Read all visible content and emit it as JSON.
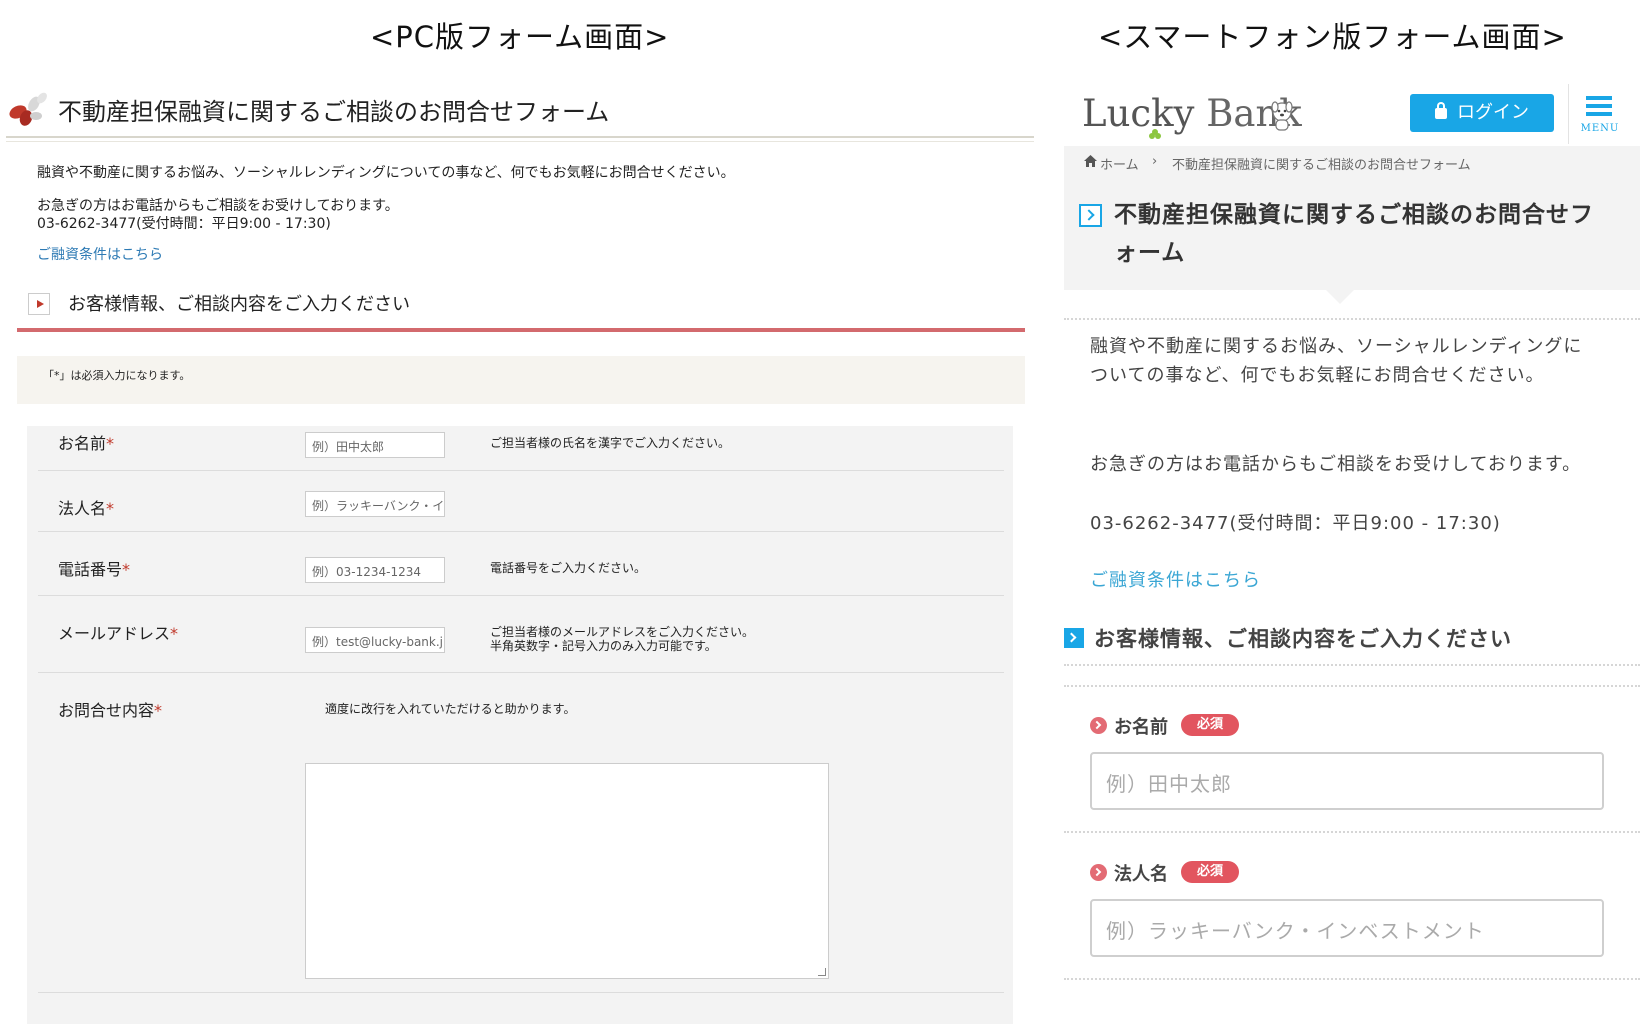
{
  "captions": {
    "pc": "<PC版フォーム画面>",
    "sp": "<スマートフォン版フォーム画面>"
  },
  "pc": {
    "title": "不動産担保融資に関するご相談のお問合せフォーム",
    "intro1": "融資や不動産に関するお悩み、ソーシャルレンディングについての事など、何でもお気軽にお問合せください。",
    "intro2": "お急ぎの方はお電話からもご相談をお受けしております。",
    "intro3": "03-6262-3477(受付時間：平日9:00 - 17:30)",
    "link": "ご融資条件はこちら",
    "section_title": "お客様情報、ご相談内容をご入力ください",
    "note": "「*」は必須入力になります。",
    "required_mark": "*",
    "fields": [
      {
        "label": "お名前",
        "placeholder": "例）田中太郎",
        "help": "ご担当者様の氏名を漢字でご入力ください。",
        "help2": ""
      },
      {
        "label": "法人名",
        "placeholder": "例）ラッキーバンク・インベストメント",
        "help": "",
        "help2": ""
      },
      {
        "label": "電話番号",
        "placeholder": "例）03-1234-1234",
        "help": "電話番号をご入力ください。",
        "help2": ""
      },
      {
        "label": "メールアドレス",
        "placeholder": "例）test@lucky-bank.jp",
        "help": "ご担当者様のメールアドレスをご入力ください。",
        "help2": "半角英数字・記号入力のみ入力可能です。"
      },
      {
        "label": "お問合せ内容",
        "placeholder": "",
        "help": "適度に改行を入れていただけると助かります。",
        "help2": ""
      }
    ]
  },
  "sp": {
    "logo_lucky": "Lucky",
    "logo_bank": "Bank",
    "login_label": "ログイン",
    "menu_label": "MENU",
    "breadcrumb_home": "ホーム",
    "breadcrumb_sep": "›",
    "breadcrumb_current": "不動産担保融資に関するご相談のお問合せフォーム",
    "title": "不動産担保融資に関するご相談のお問合せフォーム",
    "intro1": "融資や不動産に関するお悩み、ソーシャルレンディングについての事など、何でもお気軽にお問合せください。",
    "intro2": "お急ぎの方はお電話からもご相談をお受けしております。",
    "intro3": "03-6262-3477(受付時間：平日9:00 - 17:30)",
    "link": "ご融資条件はこちら",
    "section_title": "お客様情報、ご相談内容をご入力ください",
    "required_badge": "必須",
    "fields": [
      {
        "label": "お名前",
        "placeholder": "例）田中太郎"
      },
      {
        "label": "法人名",
        "placeholder": "例）ラッキーバンク・インベストメント"
      }
    ]
  },
  "colors": {
    "accent_blue": "#19a6e6",
    "accent_red": "#d36a6e",
    "badge_red": "#e2555f",
    "link_blue": "#2d7ab4"
  }
}
